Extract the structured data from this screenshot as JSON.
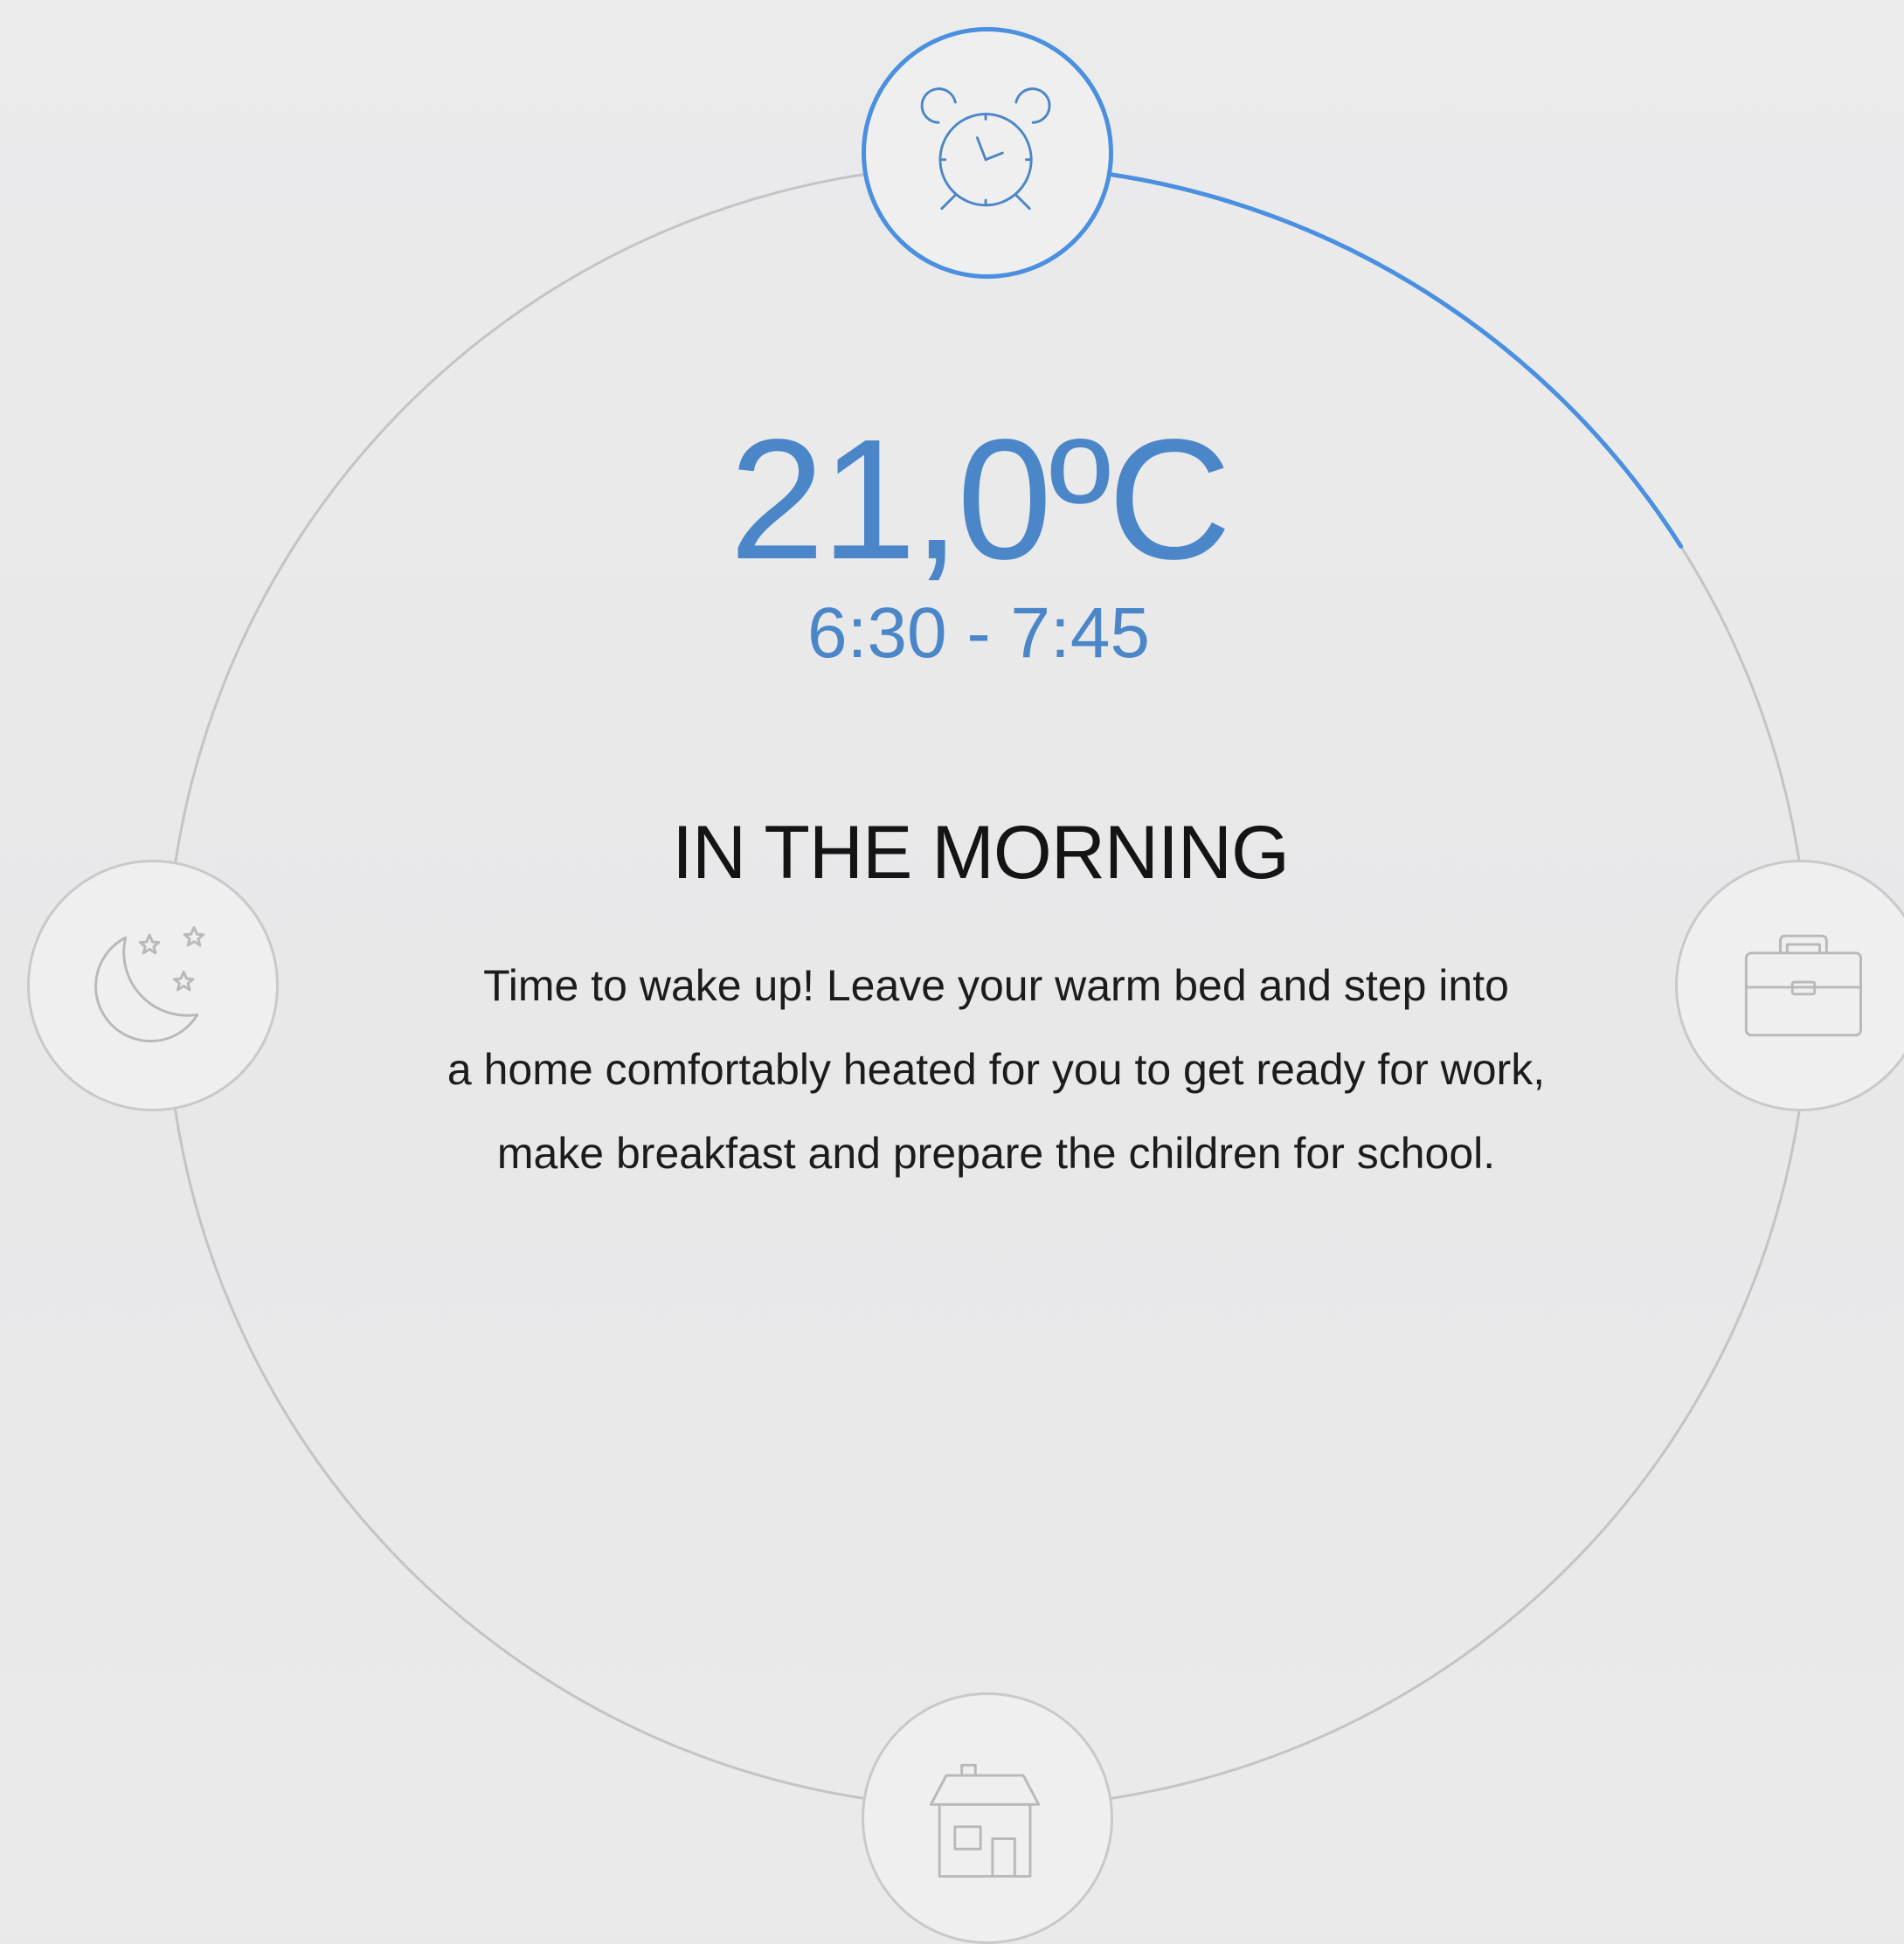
{
  "accent_color": "#4a8fe0",
  "temperature": "21,0ºC",
  "time_range": "6:30 - 7:45",
  "period_title": "IN THE MORNING",
  "description_lines": [
    "Time to wake up! Leave your warm bed and step into",
    "a home comfortably heated for you to get ready for work,",
    "make breakfast and prepare the children for school."
  ],
  "schedule_nodes": [
    {
      "period": "morning",
      "icon": "alarm-clock-icon",
      "active": true
    },
    {
      "period": "work",
      "icon": "briefcase-icon",
      "active": false
    },
    {
      "period": "home",
      "icon": "house-icon",
      "active": false
    },
    {
      "period": "night",
      "icon": "moon-stars-icon",
      "active": false
    }
  ],
  "progress_fraction": 0.16
}
